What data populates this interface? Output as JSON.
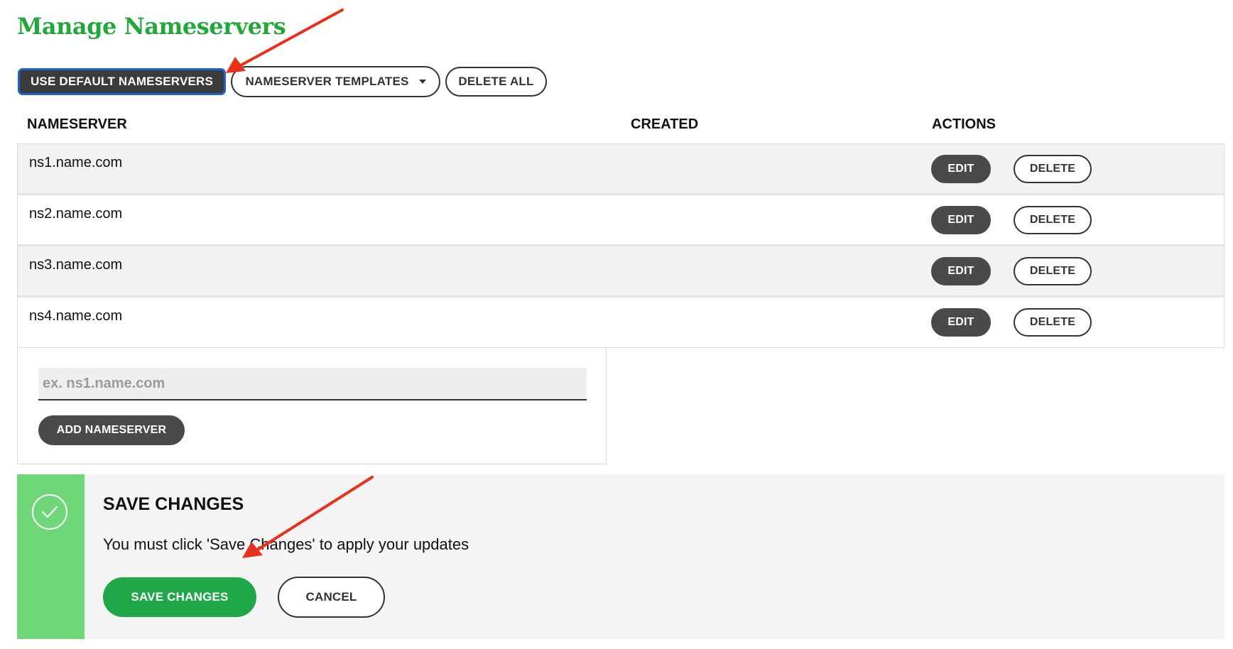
{
  "page": {
    "title": "Manage Nameservers",
    "accent_green": "#22a83a"
  },
  "toolbar": {
    "use_default_label": "USE DEFAULT NAMESERVERS",
    "templates_label": "NAMESERVER TEMPLATES",
    "delete_all_label": "DELETE ALL"
  },
  "table": {
    "headers": [
      "NAMESERVER",
      "CREATED",
      "ACTIONS"
    ],
    "rows": [
      {
        "nameserver": "ns1.name.com",
        "created": "",
        "edit_label": "EDIT",
        "delete_label": "DELETE"
      },
      {
        "nameserver": "ns2.name.com",
        "created": "",
        "edit_label": "EDIT",
        "delete_label": "DELETE"
      },
      {
        "nameserver": "ns3.name.com",
        "created": "",
        "edit_label": "EDIT",
        "delete_label": "DELETE"
      },
      {
        "nameserver": "ns4.name.com",
        "created": "",
        "edit_label": "EDIT",
        "delete_label": "DELETE"
      }
    ]
  },
  "add_form": {
    "input_value": "",
    "input_placeholder": "ex. ns1.name.com",
    "add_label": "ADD NAMESERVER"
  },
  "save_panel": {
    "icon": "check-circle-icon",
    "title": "SAVE CHANGES",
    "message": "You must click 'Save Changes' to apply your updates",
    "save_label": "SAVE CHANGES",
    "cancel_label": "CANCEL",
    "strip_color": "#6fd77a",
    "save_color": "#1fa84a"
  },
  "annotations": {
    "arrow_color": "#e8311a"
  }
}
